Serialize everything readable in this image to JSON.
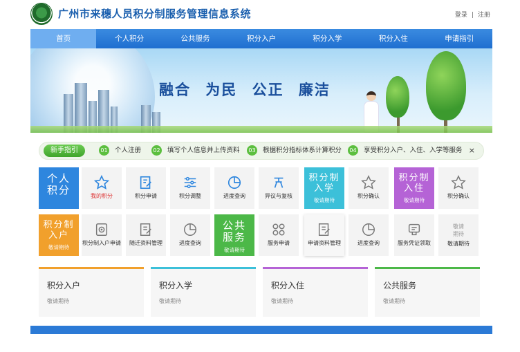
{
  "header": {
    "title": "广州市来穗人员积分制服务管理信息系统",
    "login": "登录",
    "separator": "|",
    "register": "注册"
  },
  "nav": {
    "items": [
      {
        "label": "首页",
        "active": true
      },
      {
        "label": "个人积分"
      },
      {
        "label": "公共服务"
      },
      {
        "label": "积分入户"
      },
      {
        "label": "积分入学"
      },
      {
        "label": "积分入住"
      },
      {
        "label": "申请指引"
      }
    ]
  },
  "banner": {
    "slogan": "融合 为民 公正 廉洁"
  },
  "guide": {
    "label": "新手指引",
    "steps": [
      {
        "num": "01",
        "text": "个人注册"
      },
      {
        "num": "02",
        "text": "填写个人信息并上传资料"
      },
      {
        "num": "03",
        "text": "根据积分指标体系计算积分"
      },
      {
        "num": "04",
        "text": "享受积分入户、入住、入学等服务"
      }
    ],
    "close": "×"
  },
  "tiles": {
    "personal": {
      "title": "个人积分",
      "color": "#2e86de"
    },
    "my_points": {
      "label": "我的积分",
      "icon": "star-icon"
    },
    "points_apply": {
      "label": "积分申请",
      "icon": "edit-form-icon"
    },
    "points_adjust": {
      "label": "积分调整",
      "icon": "sliders-icon"
    },
    "progress1": {
      "label": "进度查询",
      "icon": "pie-chart-icon"
    },
    "review": {
      "label": "异议与复核",
      "icon": "dispute-icon"
    },
    "school": {
      "title": "积分制入学",
      "sub": "敬请期待",
      "color": "#3cc0d9"
    },
    "points_confirm1": {
      "label": "积分确认",
      "icon": "star-outline-icon"
    },
    "housing": {
      "title": "积分制入住",
      "sub": "敬请期待",
      "color": "#b563d6"
    },
    "points_confirm2": {
      "label": "积分确认",
      "icon": "star-outline-icon"
    },
    "hukou": {
      "title": "积分制入户",
      "sub": "敬请期待",
      "color": "#f1a02c"
    },
    "hukou_apply": {
      "label": "积分制入户申请",
      "icon": "target-icon"
    },
    "material_manage": {
      "label": "随迁资料管理",
      "icon": "document-icon"
    },
    "progress2": {
      "label": "进度查询",
      "icon": "pie-chart-icon"
    },
    "public": {
      "title": "公共服务",
      "sub": "敬请期待",
      "color": "#4cb848"
    },
    "service_apply": {
      "label": "服务申请",
      "icon": "grid-icon"
    },
    "apply_material": {
      "label": "申请资料管理",
      "icon": "document-edit-icon"
    },
    "progress3": {
      "label": "进度查询",
      "icon": "pie-chart-icon"
    },
    "voucher": {
      "label": "服务凭证领取",
      "icon": "voucher-icon"
    },
    "coming": {
      "label": "敬请期待"
    }
  },
  "cards": [
    {
      "title": "积分入户",
      "sub": "敬请期待",
      "color": "#f1a02c"
    },
    {
      "title": "积分入学",
      "sub": "敬请期待",
      "color": "#3cc0d9"
    },
    {
      "title": "积分入住",
      "sub": "敬请期待",
      "color": "#b563d6"
    },
    {
      "title": "公共服务",
      "sub": "敬请期待",
      "color": "#4cb848"
    }
  ]
}
